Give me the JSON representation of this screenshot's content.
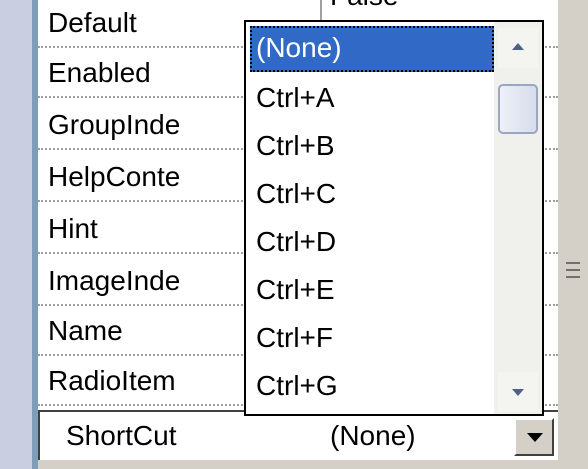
{
  "inspector": {
    "top_value": "False",
    "properties": [
      "Default",
      "Enabled",
      "GroupInde",
      "HelpConte",
      "Hint",
      "ImageInde",
      "Name",
      "RadioItem"
    ],
    "selected_property": {
      "name": "ShortCut",
      "value": "(None)"
    }
  },
  "dropdown": {
    "selected_item": "(None)",
    "items": [
      "(None)",
      "Ctrl+A",
      "Ctrl+B",
      "Ctrl+C",
      "Ctrl+D",
      "Ctrl+E",
      "Ctrl+F",
      "Ctrl+G"
    ],
    "selection_color": "#3169c6"
  },
  "icons": {
    "scroll_up": "scroll-up-arrow-icon",
    "scroll_down": "scroll-down-arrow-icon",
    "combo_dropdown": "dropdown-arrow-icon",
    "panel_grip": "splitter-grip-icon"
  }
}
